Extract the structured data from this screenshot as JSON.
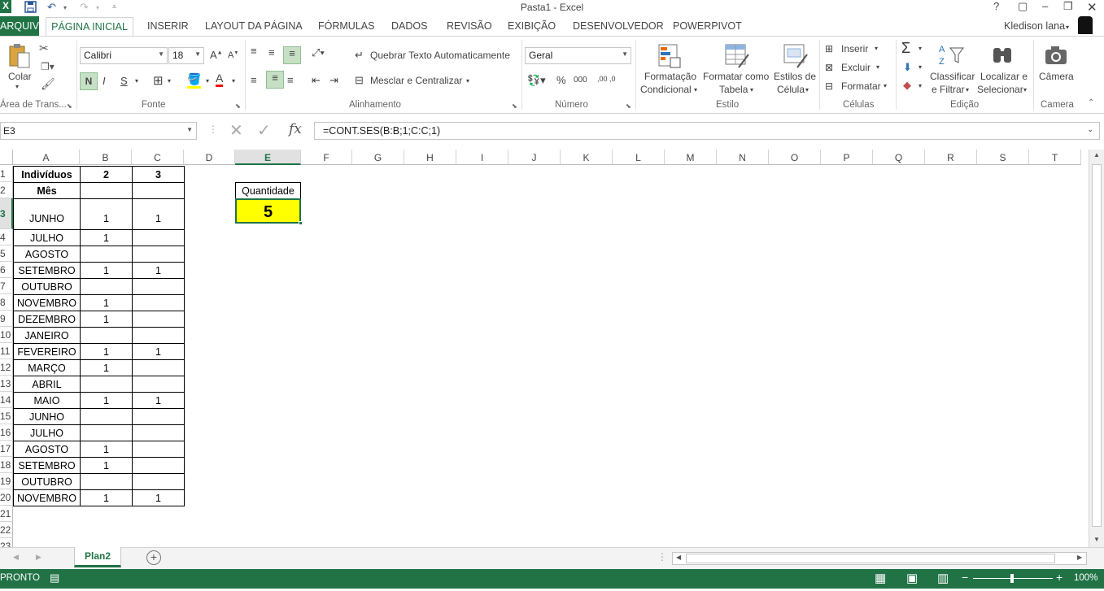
{
  "window": {
    "title": "Pasta1 - Excel",
    "help": "?",
    "user": "Kledison lana"
  },
  "quick_access": {
    "app_letter": "X",
    "save_icon": "save-icon",
    "undo_icon": "undo-icon",
    "redo_icon": "redo-icon"
  },
  "tabs": [
    "ARQUIVO",
    "PÁGINA INICIAL",
    "INSERIR",
    "LAYOUT DA PÁGINA",
    "FÓRMULAS",
    "DADOS",
    "REVISÃO",
    "EXIBIÇÃO",
    "DESENVOLVEDOR",
    "POWERPIVOT"
  ],
  "ribbon": {
    "clipboard": {
      "paste": "Colar",
      "label": "Área de Trans..."
    },
    "font": {
      "name": "Calibri",
      "size": "18",
      "bold": "N",
      "italic": "I",
      "underline": "S",
      "label": "Fonte"
    },
    "alignment": {
      "wrap": "Quebrar Texto Automaticamente",
      "merge": "Mesclar e Centralizar",
      "label": "Alinhamento"
    },
    "number": {
      "format": "Geral",
      "percent": "%",
      "thousands": "000",
      "inc_decimal": ",00 ,0",
      "label": "Número"
    },
    "styles": {
      "cond": [
        "Formatação",
        "Condicional"
      ],
      "table": [
        "Formatar como",
        "Tabela"
      ],
      "cell": [
        "Estilos de",
        "Célula"
      ],
      "label": "Estilo"
    },
    "cells": {
      "insert": "Inserir",
      "delete": "Excluir",
      "format": "Formatar",
      "label": "Células"
    },
    "editing": {
      "sort": [
        "Classificar",
        "e Filtrar"
      ],
      "find": [
        "Localizar e",
        "Selecionar"
      ],
      "label": "Edição"
    },
    "camera": {
      "btn": "Câmera",
      "label": "Camera"
    }
  },
  "formula_bar": {
    "name_box": "E3",
    "formula": "=CONT.SES(B:B;1;C:C;1)",
    "fx": "fx"
  },
  "columns": [
    "A",
    "B",
    "C",
    "D",
    "E",
    "F",
    "G",
    "H",
    "I",
    "J",
    "K",
    "L",
    "M",
    "N",
    "O",
    "P",
    "Q",
    "R",
    "S",
    "T"
  ],
  "rows": [
    {
      "n": "1",
      "a": "Indivíduos",
      "b": "2",
      "c": "3"
    },
    {
      "n": "2",
      "a": "Mês",
      "b": "",
      "c": ""
    },
    {
      "n": "3",
      "a": "JUNHO",
      "b": "1",
      "c": "1"
    },
    {
      "n": "4",
      "a": "JULHO",
      "b": "1",
      "c": ""
    },
    {
      "n": "5",
      "a": "AGOSTO",
      "b": "",
      "c": ""
    },
    {
      "n": "6",
      "a": "SETEMBRO",
      "b": "1",
      "c": "1"
    },
    {
      "n": "7",
      "a": "OUTUBRO",
      "b": "",
      "c": ""
    },
    {
      "n": "8",
      "a": "NOVEMBRO",
      "b": "1",
      "c": ""
    },
    {
      "n": "9",
      "a": "DEZEMBRO",
      "b": "1",
      "c": ""
    },
    {
      "n": "10",
      "a": "JANEIRO",
      "b": "",
      "c": ""
    },
    {
      "n": "11",
      "a": "FEVEREIRO",
      "b": "1",
      "c": "1"
    },
    {
      "n": "12",
      "a": "MARÇO",
      "b": "1",
      "c": ""
    },
    {
      "n": "13",
      "a": "ABRIL",
      "b": "",
      "c": ""
    },
    {
      "n": "14",
      "a": "MAIO",
      "b": "1",
      "c": "1"
    },
    {
      "n": "15",
      "a": "JUNHO",
      "b": "",
      "c": ""
    },
    {
      "n": "16",
      "a": "JULHO",
      "b": "",
      "c": ""
    },
    {
      "n": "17",
      "a": "AGOSTO",
      "b": "1",
      "c": ""
    },
    {
      "n": "18",
      "a": "SETEMBRO",
      "b": "1",
      "c": ""
    },
    {
      "n": "19",
      "a": "OUTUBRO",
      "b": "",
      "c": ""
    },
    {
      "n": "20",
      "a": "NOVEMBRO",
      "b": "1",
      "c": "1"
    },
    {
      "n": "21",
      "a": "",
      "b": "",
      "c": ""
    },
    {
      "n": "22",
      "a": "",
      "b": "",
      "c": ""
    },
    {
      "n": "23",
      "a": "",
      "b": "",
      "c": ""
    }
  ],
  "e_cells": {
    "label": "Quantidade",
    "value": "5",
    "fill": "#ffff00"
  },
  "sheets": {
    "active": "Plan2"
  },
  "status": {
    "mode": "PRONTO",
    "zoom": "100%"
  },
  "colors": {
    "accent": "#217346"
  }
}
